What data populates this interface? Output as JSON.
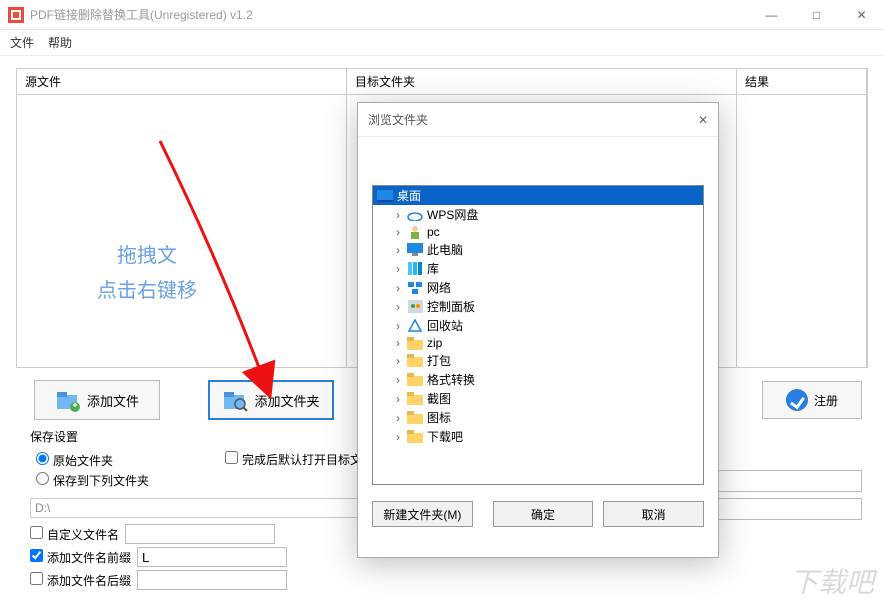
{
  "window": {
    "title": "PDF链接删除替换工具(Unregistered) v1.2",
    "menu": {
      "file": "文件",
      "help": "帮助"
    },
    "winctl": {
      "min": "—",
      "max": "□",
      "close": "✕"
    }
  },
  "columns": {
    "source": "源文件",
    "target": "目标文件夹",
    "result": "结果"
  },
  "placeholder": {
    "line1": "拖拽文",
    "line2": "点击右键移"
  },
  "buttons": {
    "add_file": "添加文件",
    "add_folder": "添加文件夹",
    "register": "注册"
  },
  "save": {
    "group_title": "保存设置",
    "radio_original": "原始文件夹",
    "radio_below": "保存到下列文件夹",
    "chk_open_after": "完成后默认打开目标文件",
    "path": "D:\\",
    "chk_custom_name": "自定义文件名",
    "chk_prefix": "添加文件名前缀",
    "chk_suffix": "添加文件名后缀",
    "prefix_value": "L"
  },
  "dialog": {
    "title": "浏览文件夹",
    "tree_root": "桌面",
    "items": [
      {
        "icon": "cloud",
        "label": "WPS网盘"
      },
      {
        "icon": "user",
        "label": "pc"
      },
      {
        "icon": "computer",
        "label": "此电脑"
      },
      {
        "icon": "library",
        "label": "库"
      },
      {
        "icon": "network",
        "label": "网络"
      },
      {
        "icon": "cpanel",
        "label": "控制面板"
      },
      {
        "icon": "recycle",
        "label": "回收站"
      },
      {
        "icon": "folder",
        "label": "zip"
      },
      {
        "icon": "folder",
        "label": "打包"
      },
      {
        "icon": "folder",
        "label": "格式转换"
      },
      {
        "icon": "folder",
        "label": "截图"
      },
      {
        "icon": "folder",
        "label": "图标"
      },
      {
        "icon": "folder",
        "label": "下载吧"
      }
    ],
    "btn_new": "新建文件夹(M)",
    "btn_ok": "确定",
    "btn_cancel": "取消"
  },
  "watermark": "下载吧"
}
